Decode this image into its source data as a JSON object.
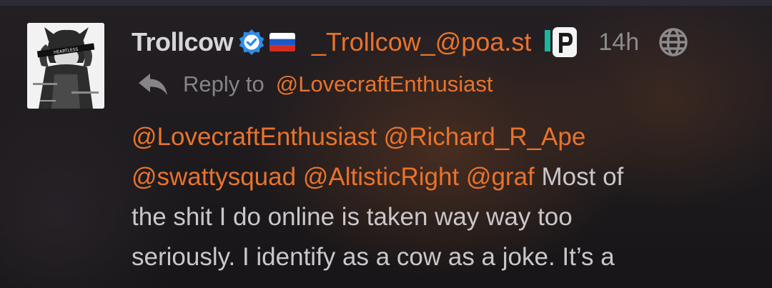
{
  "post": {
    "author": {
      "display_name": "Trollcow",
      "handle": "_Trollcow_@poa.st",
      "avatar_text": "HEARTLESS",
      "flag": "🇷🇺"
    },
    "time": "14h",
    "reply": {
      "label": "Reply to",
      "target": "@LovecraftEnthusiast"
    },
    "body": {
      "line1": {
        "mention1": "@LovecraftEnthusiast",
        "mention2": "@Richard_R_Ape"
      },
      "line2": {
        "mention1": "@swattysquad",
        "mention2": "@AltisticRight",
        "mention3": "@graf",
        "text": "Most of"
      },
      "line3": "the shit I do online is taken way way too",
      "line4": "seriously. I identify as a cow as a joke. It’s a"
    }
  },
  "icons": {
    "verified": "verified-badge-icon",
    "app": "pleroma-app-icon",
    "visibility": "globe-icon",
    "reply": "reply-arrow-icon"
  },
  "colors": {
    "accent": "#e8732c",
    "verified": "#2e8de6",
    "text": "#c9c7c9",
    "muted": "#868486",
    "background": "#1c1a1c"
  }
}
